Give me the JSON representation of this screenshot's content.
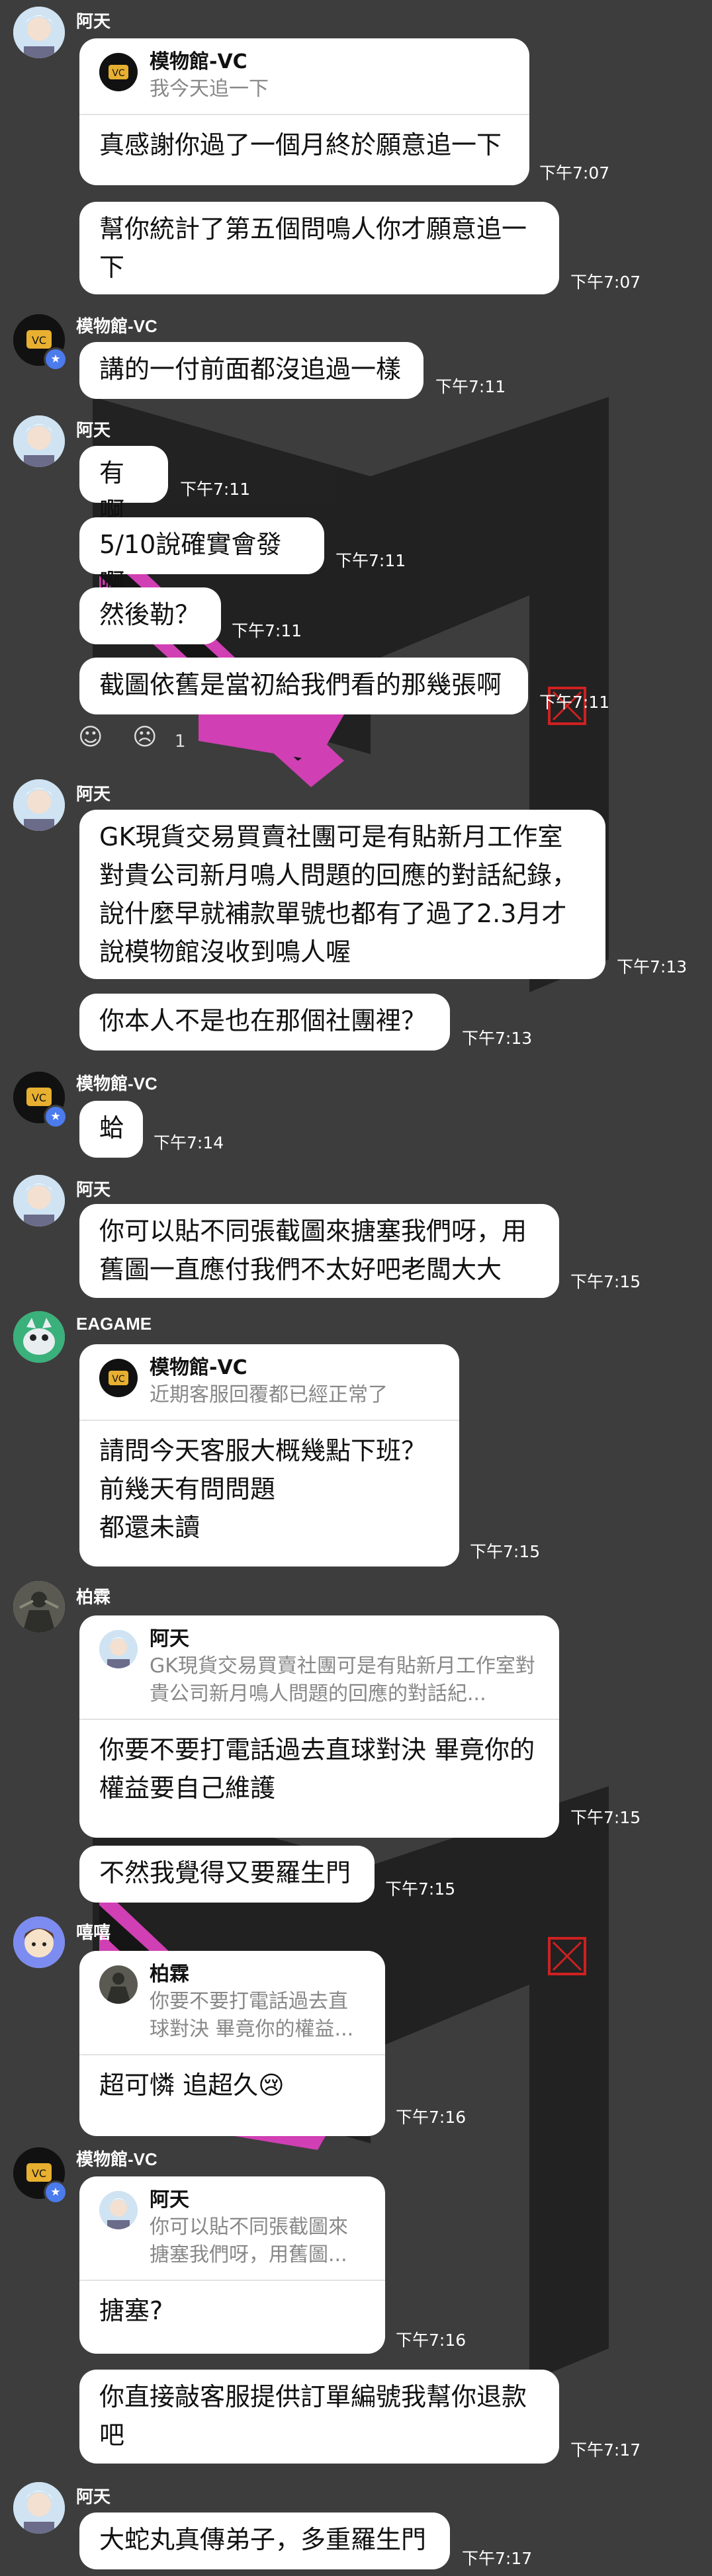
{
  "accent_colors": {
    "background": "#3d3d3d",
    "bubble": "#ffffff",
    "badge": "#4b7bec"
  },
  "messages": [
    {
      "id": "m1",
      "sender": "阿天",
      "reply": {
        "name": "模物館-VC",
        "text": "我今天追一下"
      },
      "text": "真感謝你過了一個月終於願意追一下",
      "time": "下午7:07"
    },
    {
      "id": "m2",
      "text": "幫你統計了第五個問鳴人你才願意追一下",
      "time": "下午7:07"
    },
    {
      "id": "m3",
      "sender": "模物館-VC",
      "text": "講的一付前面都沒追過一樣",
      "time": "下午7:11"
    },
    {
      "id": "m4",
      "sender": "阿天",
      "text": "有啊",
      "time": "下午7:11"
    },
    {
      "id": "m5",
      "text": "5/10說確實會發啊",
      "time": "下午7:11"
    },
    {
      "id": "m6",
      "text": "然後勒？",
      "time": "下午7:11"
    },
    {
      "id": "m7",
      "text": "截圖依舊是當初給我們看的那幾張啊",
      "time": "下午7:11",
      "reaction_count": "1"
    },
    {
      "id": "m8",
      "sender": "阿天",
      "text": "GK現貨交易買賣社團可是有貼新月工作室對貴公司新月鳴人問題的回應的對話紀錄，說什麼早就補款單號也都有了過了2.3月才說模物館沒收到鳴人喔",
      "time": "下午7:13"
    },
    {
      "id": "m9",
      "text": "你本人不是也在那個社團裡？",
      "time": "下午7:13"
    },
    {
      "id": "m10",
      "sender": "模物館-VC",
      "text": "蛤",
      "time": "下午7:14"
    },
    {
      "id": "m11",
      "sender": "阿天",
      "text": "你可以貼不同張截圖來搪塞我們呀，用舊圖一直應付我們不太好吧老闆大大",
      "time": "下午7:15"
    },
    {
      "id": "m12",
      "sender": "EAGAME",
      "reply": {
        "name": "模物館-VC",
        "text": "近期客服回覆都已經正常了"
      },
      "text": "請問今天客服大概幾點下班？\n前幾天有問問題\n都還未讀",
      "time": "下午7:15"
    },
    {
      "id": "m13",
      "sender": "柏霖",
      "reply": {
        "name": "阿天",
        "text": "GK現貨交易買賣社團可是有貼新月工作室對貴公司新月鳴人問題的回應的對話紀..."
      },
      "text": "你要不要打電話過去直球對決 畢竟你的權益要自己維護",
      "time": "下午7:15"
    },
    {
      "id": "m14",
      "text": "不然我覺得又要羅生門",
      "time": "下午7:15"
    },
    {
      "id": "m15",
      "sender": "嘻嘻",
      "reply": {
        "name": "柏霖",
        "text": "你要不要打電話過去直球對決 畢竟你的權益..."
      },
      "text": "超可憐 追超久😢",
      "time": "下午7:16"
    },
    {
      "id": "m16",
      "sender": "模物館-VC",
      "reply": {
        "name": "阿天",
        "text": "你可以貼不同張截圖來搪塞我們呀，用舊圖..."
      },
      "text": "搪塞?",
      "time": "下午7:16"
    },
    {
      "id": "m17",
      "text": "你直接敲客服提供訂單編號我幫你退款吧",
      "time": "下午7:17"
    },
    {
      "id": "m18",
      "sender": "阿天",
      "text": "大蛇丸真傳弟子，多重羅生門",
      "time": "下午7:17"
    }
  ]
}
